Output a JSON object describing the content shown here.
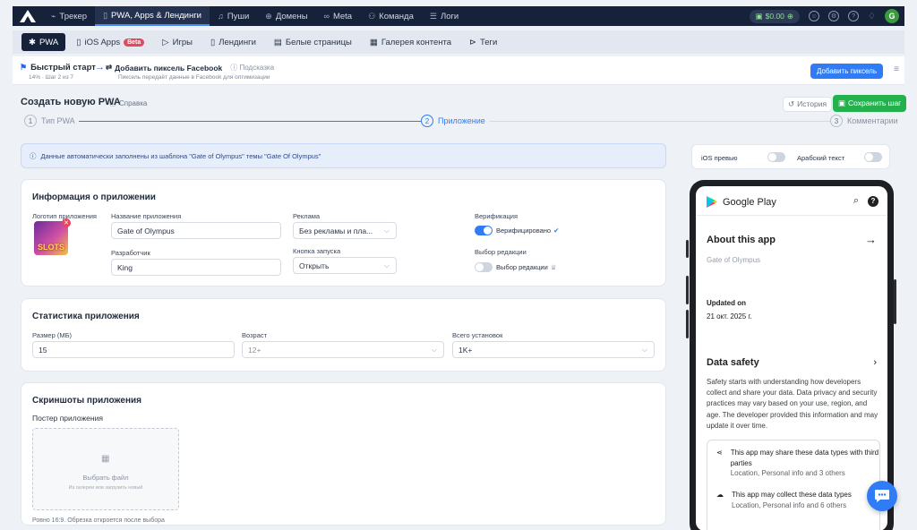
{
  "topnav": {
    "items": [
      {
        "label": "Трекер",
        "icon": "chart-icon"
      },
      {
        "label": "PWA, Apps & Лендинги",
        "icon": "phone-icon"
      },
      {
        "label": "Пуши",
        "icon": "bell-icon"
      },
      {
        "label": "Домены",
        "icon": "globe-icon"
      },
      {
        "label": "Meta",
        "icon": "infinity-icon"
      },
      {
        "label": "Команда",
        "icon": "team-icon"
      },
      {
        "label": "Логи",
        "icon": "list-icon"
      }
    ],
    "balance": "$0.00",
    "avatar": "G"
  },
  "subnav": {
    "items": [
      {
        "label": "PWA",
        "icon": "android-icon"
      },
      {
        "label": "iOS Apps",
        "icon": "phone-icon",
        "badge": "Beta"
      },
      {
        "label": "Игры",
        "icon": "play-icon"
      },
      {
        "label": "Лендинги",
        "icon": "phone-icon"
      },
      {
        "label": "Белые страницы",
        "icon": "page-icon"
      },
      {
        "label": "Галерея контента",
        "icon": "gallery-icon"
      },
      {
        "label": "Теги",
        "icon": "tag-icon"
      }
    ]
  },
  "quickstart": {
    "title": "Быстрый старт",
    "progress": "14% · Шаг 2 из 7",
    "step_title": "Добавить пиксель Facebook",
    "hint": "Подсказка",
    "step_desc": "Пиксель передаёт данные в Facebook для оптимизации",
    "button": "Добавить пиксель"
  },
  "page": {
    "title": "Создать новую PWA",
    "help": "Справка",
    "history": "История",
    "save": "Сохранить шаг"
  },
  "stepper": {
    "steps": [
      {
        "num": "1",
        "label": "Тип PWA"
      },
      {
        "num": "2",
        "label": "Приложение"
      },
      {
        "num": "3",
        "label": "Комментарии"
      }
    ]
  },
  "alert": "Данные автоматически заполнены из шаблона \"Gate of Olympus\" темы \"Gate Of Olympus\"",
  "app_info": {
    "title": "Информация о приложении",
    "logo_label": "Логотип приложения",
    "logo_text": "SLOTS",
    "name_label": "Название приложения",
    "name_value": "Gate of Olympus",
    "dev_label": "Разработчик",
    "dev_value": "King",
    "ads_label": "Реклама",
    "ads_value": "Без рекламы и пла...",
    "launch_label": "Кнопка запуска",
    "launch_value": "Открыть",
    "verify_label": "Верификация",
    "verify_value": "Верифицировано",
    "editor_label": "Выбор редакции",
    "editor_value": "Выбор редакции"
  },
  "stats": {
    "title": "Статистика приложения",
    "size_label": "Размер (МБ)",
    "size_value": "15",
    "age_label": "Возраст",
    "age_value": "12+",
    "installs_label": "Всего установок",
    "installs_value": "1K+"
  },
  "screenshots": {
    "title": "Скриншоты приложения",
    "poster_label": "Постер приложения",
    "upload_title": "Выбрать файл",
    "upload_sub": "Из галереи или загрузить новый",
    "note": "Ровно 16:9. Обрезка откроется после выбора"
  },
  "preview": {
    "ios_label": "iOS превью",
    "arabic_label": "Арабский текст",
    "store": "Google Play",
    "about": "About this app",
    "about_sub": "Gate of Olympus",
    "updated_label": "Updated on",
    "updated_value": "21 окт. 2025 г.",
    "data_safety": "Data safety",
    "ds_text": "Safety starts with understanding how developers collect and share your data. Data privacy and security practices may vary based on your use, region, and age. The developer provided this information and may update it over time.",
    "ds_items": [
      {
        "title": "This app may share these data types with third parties",
        "sub": "Location, Personal info and 3 others"
      },
      {
        "title": "This app may collect these data types",
        "sub": "Location, Personal info and 6 others"
      }
    ]
  },
  "colors": {
    "accent": "#2f7cf6",
    "nav": "#16213a",
    "success": "#22b14c",
    "danger": "#e7475e"
  }
}
